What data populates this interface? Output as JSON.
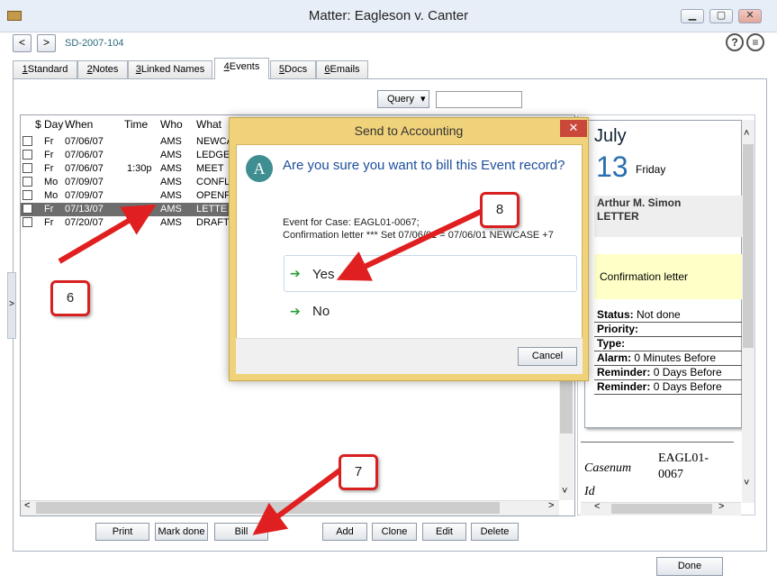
{
  "window": {
    "title": "Matter: Eagleson v. Canter",
    "matter_number": "SD-2007-104",
    "min": "▁",
    "max": "▢",
    "close": "✕"
  },
  "nav": {
    "back": "<",
    "forward": ">",
    "help": "?",
    "menu": "≡"
  },
  "tabs": [
    {
      "num": "1",
      "label": "Standard"
    },
    {
      "num": "2",
      "label": "Notes"
    },
    {
      "num": "3",
      "label": "Linked Names"
    },
    {
      "num": "4",
      "label": "Events"
    },
    {
      "num": "5",
      "label": "Docs"
    },
    {
      "num": "6",
      "label": "Emails"
    }
  ],
  "query": {
    "label": "Query",
    "caret": "▾",
    "value": ""
  },
  "grid": {
    "headers": {
      "dollar": "$",
      "day": "Day",
      "when": "When",
      "time": "Time",
      "who": "Who",
      "what": "What"
    },
    "rows": [
      {
        "day": "Fr",
        "when": "07/06/07",
        "time": "",
        "who": "AMS",
        "what": "NEWCA"
      },
      {
        "day": "Fr",
        "when": "07/06/07",
        "time": "",
        "who": "AMS",
        "what": "LEDGE"
      },
      {
        "day": "Fr",
        "when": "07/06/07",
        "time": "1:30p",
        "who": "AMS",
        "what": "MEET"
      },
      {
        "day": "Mo",
        "when": "07/09/07",
        "time": "",
        "who": "AMS",
        "what": "CONFL"
      },
      {
        "day": "Mo",
        "when": "07/09/07",
        "time": "",
        "who": "AMS",
        "what": "OPENF"
      },
      {
        "day": "Fr",
        "when": "07/13/07",
        "time": "",
        "who": "AMS",
        "what": "LETTE"
      },
      {
        "day": "Fr",
        "when": "07/20/07",
        "time": "",
        "who": "AMS",
        "what": "DRAFT"
      }
    ],
    "selected_row": 5
  },
  "buttons": {
    "print": "Print",
    "mark_done": "Mark done",
    "bill": "Bill",
    "add": "Add",
    "clone": "Clone",
    "edit": "Edit",
    "delete": "Delete",
    "done": "Done"
  },
  "side_toggle": ">",
  "detail": {
    "month": "July",
    "day_number": "13",
    "day_name": "Friday",
    "person": "Arthur M. Simon",
    "event_type": "LETTER",
    "description": "Confirmation letter",
    "fields": [
      {
        "key": "Status:",
        "value": "Not done"
      },
      {
        "key": "Priority:",
        "value": ""
      },
      {
        "key": "Type:",
        "value": ""
      },
      {
        "key": "Alarm:",
        "value": "0 Minutes Before"
      },
      {
        "key": "Reminder:",
        "value": "0 Days Before"
      },
      {
        "key": "Reminder:",
        "value": "0 Days Before"
      }
    ],
    "casenum_label": "Casenum",
    "casenum_value": "EAGL01-0067",
    "id_label": "Id"
  },
  "dialog": {
    "title": "Send to Accounting",
    "close": "✕",
    "logo": "A",
    "question": "Are you sure you want to bill this Event record?",
    "line1": "Event for Case: EAGL01-0067;",
    "line2": "Confirmation letter *** Set 07/06/01 = 07/06/01 NEWCASE +7",
    "yes": "Yes",
    "no": "No",
    "cancel": "Cancel"
  },
  "callouts": {
    "c6": "6",
    "c7": "7",
    "c8": "8"
  },
  "scroll": {
    "up": "▲",
    "down": "▼",
    "left": "◀",
    "right": "▶",
    "up_small": "˄",
    "down_small": "˅",
    "left_small": "<",
    "right_small": ">"
  },
  "colors": {
    "accent": "#1c4e9c",
    "callout": "#d82020",
    "dialog_frame": "#f0d27a",
    "selected_row": "#6d6d6d",
    "yellow_note": "#ffffc8"
  }
}
